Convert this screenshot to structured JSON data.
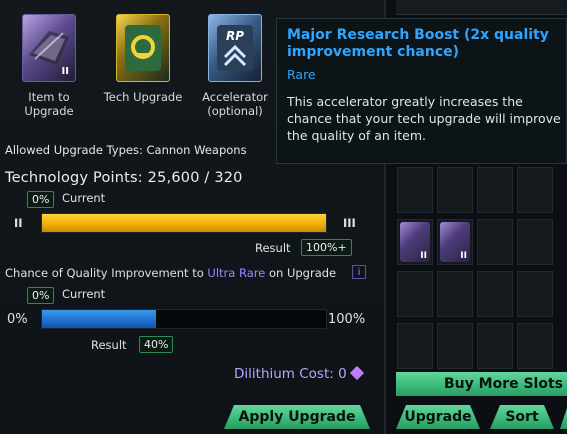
{
  "slots": [
    {
      "label": "Item to\nUpgrade",
      "tier": "II",
      "icon": "weapon-icon"
    },
    {
      "label": "Tech Upgrade",
      "icon": "tech-upgrade-icon"
    },
    {
      "label": "Accelerator\n(optional)",
      "icon": "accelerator-icon",
      "icon_text": "RP"
    }
  ],
  "allowed_types": "Allowed Upgrade Types: Cannon Weapons",
  "tech_points": {
    "label": "Technology Points: 25,600 / 320",
    "current_badge": "0%",
    "current_label": "Current",
    "left_tier": "II",
    "right_tier": "III",
    "fill_fraction": 1.0,
    "result_label": "Result",
    "result_badge": "100%+"
  },
  "quality": {
    "text_prefix": "Chance of Quality Improvement to ",
    "rarity": "Ultra Rare",
    "text_suffix": " on Upgrade",
    "info_label": "i",
    "current_badge": "0%",
    "current_label": "Current",
    "left_pct": "0%",
    "right_pct": "100%",
    "fill_fraction": 0.4,
    "result_label": "Result",
    "result_badge": "40%"
  },
  "dilithium": {
    "label": "Dilithium Cost: 0",
    "icon": "dilithium-icon"
  },
  "buttons": {
    "apply": "Apply Upgrade",
    "buy_slots": "Buy More Slots",
    "upgrade": "Upgrade",
    "sort": "Sort"
  },
  "tooltip": {
    "title": "Major Research Boost (2x quality improvement chance)",
    "rarity": "Rare",
    "description": "This accelerator greatly increases the chance that your tech upgrade will improve the quality of an item."
  },
  "inventory": {
    "items": [
      {
        "tier": "II",
        "icon": "weapon-icon"
      },
      {
        "tier": "II",
        "icon": "weapon-icon"
      }
    ]
  },
  "colors": {
    "accent_green": "#38b878",
    "tooltip_blue": "#2fa5ff",
    "progress_yellow": "#f1b10e",
    "progress_blue": "#1e6fd0",
    "rarity_purple": "#9a86ff"
  }
}
